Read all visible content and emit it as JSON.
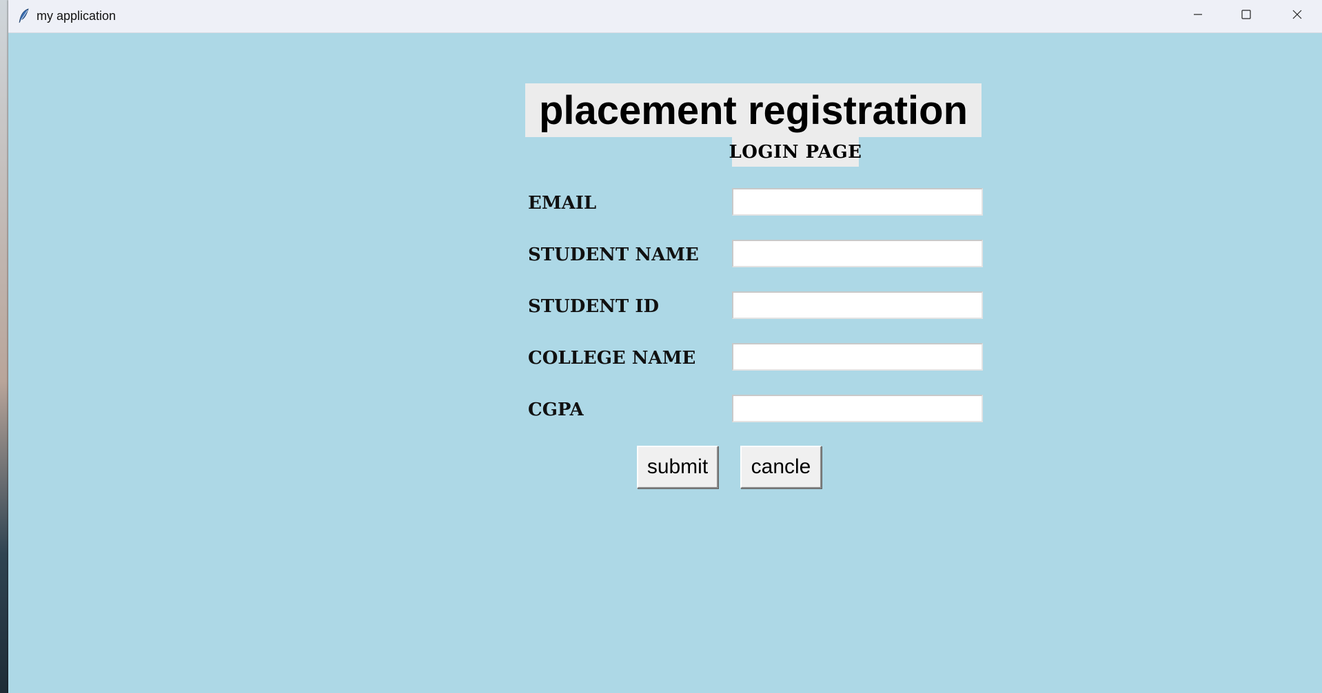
{
  "window": {
    "title": "my application",
    "icon": "feather-icon",
    "controls": {
      "minimize": "minimize-icon",
      "maximize": "maximize-icon",
      "close": "close-icon"
    },
    "background": "#add8e6"
  },
  "form": {
    "heading": "placement registration",
    "subheading": "LOGIN PAGE",
    "fields": [
      {
        "label": "EMAIL",
        "value": ""
      },
      {
        "label": "STUDENT NAME",
        "value": ""
      },
      {
        "label": "STUDENT ID",
        "value": ""
      },
      {
        "label": "COLLEGE NAME",
        "value": ""
      },
      {
        "label": "CGPA",
        "value": ""
      }
    ],
    "submit_label": "submit",
    "cancel_label": "cancle"
  }
}
